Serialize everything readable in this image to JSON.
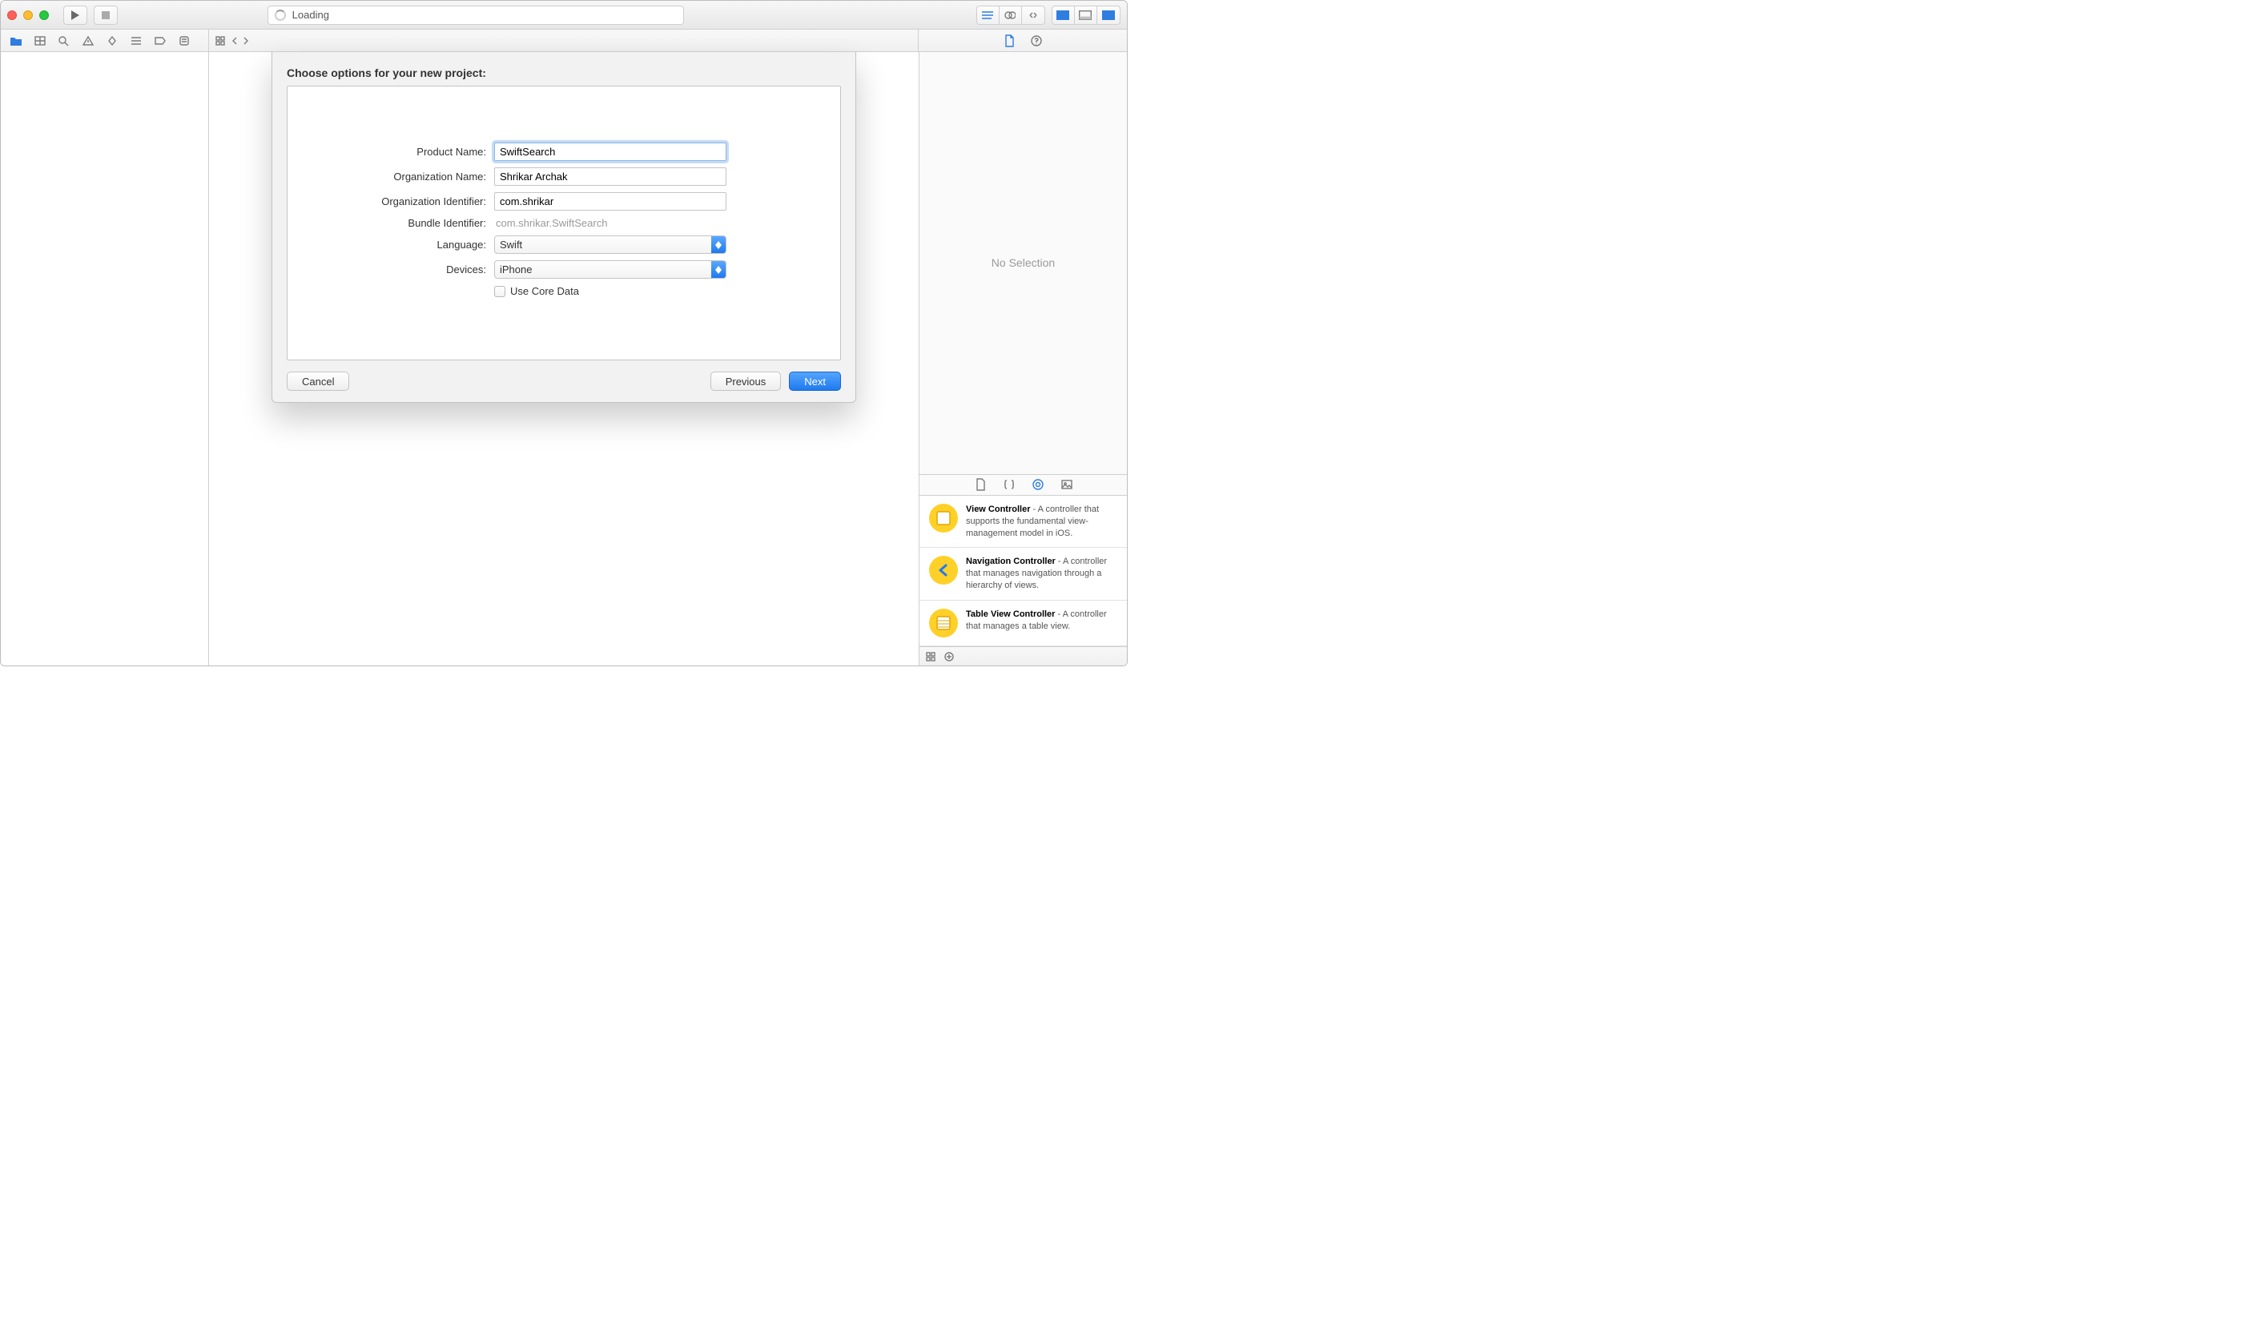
{
  "titlebar": {
    "loading_text": "Loading"
  },
  "inspector": {
    "placeholder": "No Selection"
  },
  "library": {
    "items": [
      {
        "title": "View Controller",
        "desc": "A controller that supports the fundamental view-management model in iOS."
      },
      {
        "title": "Navigation Controller",
        "desc": "A controller that manages navigation through a hierarchy of views."
      },
      {
        "title": "Table View Controller",
        "desc": "A controller that manages a table view."
      }
    ]
  },
  "sheet": {
    "title": "Choose options for your new project:",
    "labels": {
      "product_name": "Product Name:",
      "org_name": "Organization Name:",
      "org_id": "Organization Identifier:",
      "bundle_id": "Bundle Identifier:",
      "language": "Language:",
      "devices": "Devices:",
      "core_data": "Use Core Data"
    },
    "values": {
      "product_name": "SwiftSearch",
      "org_name": "Shrikar Archak",
      "org_id": "com.shrikar",
      "bundle_id": "com.shrikar.SwiftSearch",
      "language": "Swift",
      "devices": "iPhone",
      "core_data_checked": false
    },
    "buttons": {
      "cancel": "Cancel",
      "previous": "Previous",
      "next": "Next"
    }
  }
}
